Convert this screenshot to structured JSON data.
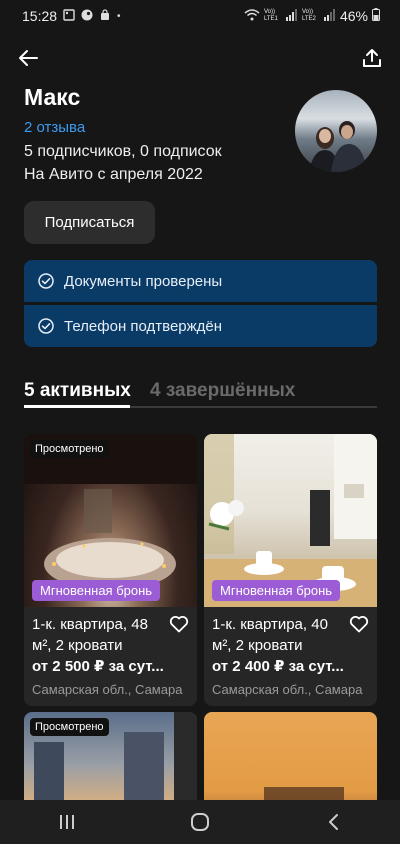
{
  "status_bar": {
    "time": "15:28",
    "battery": "46%",
    "sim1": "Vo)) LTE1",
    "sim2": "Vo)) LTE2"
  },
  "profile": {
    "name": "Макс",
    "reviews": "2 отзыва",
    "subscriptions": "5 подписчиков, 0 подписок",
    "since": "На Авито с апреля 2022",
    "subscribe_label": "Подписаться"
  },
  "verifications": [
    {
      "label": "Документы проверены"
    },
    {
      "label": "Телефон подтверждён"
    }
  ],
  "tabs": [
    {
      "label": "5 активных",
      "active": true
    },
    {
      "label": "4 завершённых",
      "active": false
    }
  ],
  "listings": [
    {
      "badge": "Просмотрено",
      "instant": "Мгновенная бронь",
      "title": "1-к. квартира, 48 м², 2 кровати",
      "price": "от 2 500 ₽ за сут...",
      "location": "Самарская обл., Самара"
    },
    {
      "instant": "Мгновенная бронь",
      "title": "1-к. квартира, 40 м², 2 кровати",
      "price": "от 2 400 ₽ за сут...",
      "location": "Самарская обл., Самара"
    },
    {
      "badge": "Просмотрено"
    },
    {}
  ],
  "colors": {
    "background": "#161616",
    "link": "#3b9bf0",
    "verify_bg": "#0a3a66",
    "instant_badge": "#9b5cd6"
  }
}
